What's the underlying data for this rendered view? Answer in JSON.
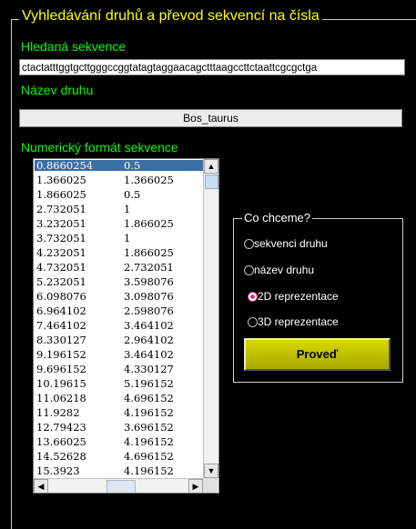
{
  "title": "Vyhledávání druhů a převod sekvencí na čísla",
  "sequence": {
    "label": "Hledaná sekvence",
    "value": "ctactatttggtgcttgggccggtatagtaggaacagctttaagccttctaattcgcgctga"
  },
  "species": {
    "label": "Název druhu",
    "value": "Bos_taurus"
  },
  "numeric": {
    "label": "Numerický formát sekvence",
    "rows": [
      [
        "0.8660254",
        "0.5"
      ],
      [
        "1.366025",
        "1.366025"
      ],
      [
        "1.866025",
        "0.5"
      ],
      [
        "2.732051",
        "1"
      ],
      [
        "3.232051",
        "1.866025"
      ],
      [
        "3.732051",
        "1"
      ],
      [
        "4.232051",
        "1.866025"
      ],
      [
        "4.732051",
        "2.732051"
      ],
      [
        "5.232051",
        "3.598076"
      ],
      [
        "6.098076",
        "3.098076"
      ],
      [
        "6.964102",
        "2.598076"
      ],
      [
        "7.464102",
        "3.464102"
      ],
      [
        "8.330127",
        "2.964102"
      ],
      [
        "9.196152",
        "3.464102"
      ],
      [
        "9.696152",
        "4.330127"
      ],
      [
        "10.19615",
        "5.196152"
      ],
      [
        "11.06218",
        "4.696152"
      ],
      [
        "11.9282",
        "4.196152"
      ],
      [
        "12.79423",
        "3.696152"
      ],
      [
        "13.66025",
        "4.196152"
      ],
      [
        "14.52628",
        "4.696152"
      ],
      [
        "15.3923",
        "4.196152"
      ]
    ],
    "selected_row": 0
  },
  "options": {
    "title": "Co chceme?",
    "items": [
      {
        "label": "sekvenci druhu",
        "selected": false
      },
      {
        "label": "název druhu",
        "selected": false
      },
      {
        "label": "2D reprezentace",
        "selected": true
      },
      {
        "label": "3D reprezentace",
        "selected": false
      }
    ]
  },
  "action": {
    "label": "Proveď"
  },
  "colors": {
    "background": "#000000",
    "title": "#ffff00",
    "labels": "#00ff00",
    "button": "#c0c000",
    "selection": "#3a6ea5"
  }
}
